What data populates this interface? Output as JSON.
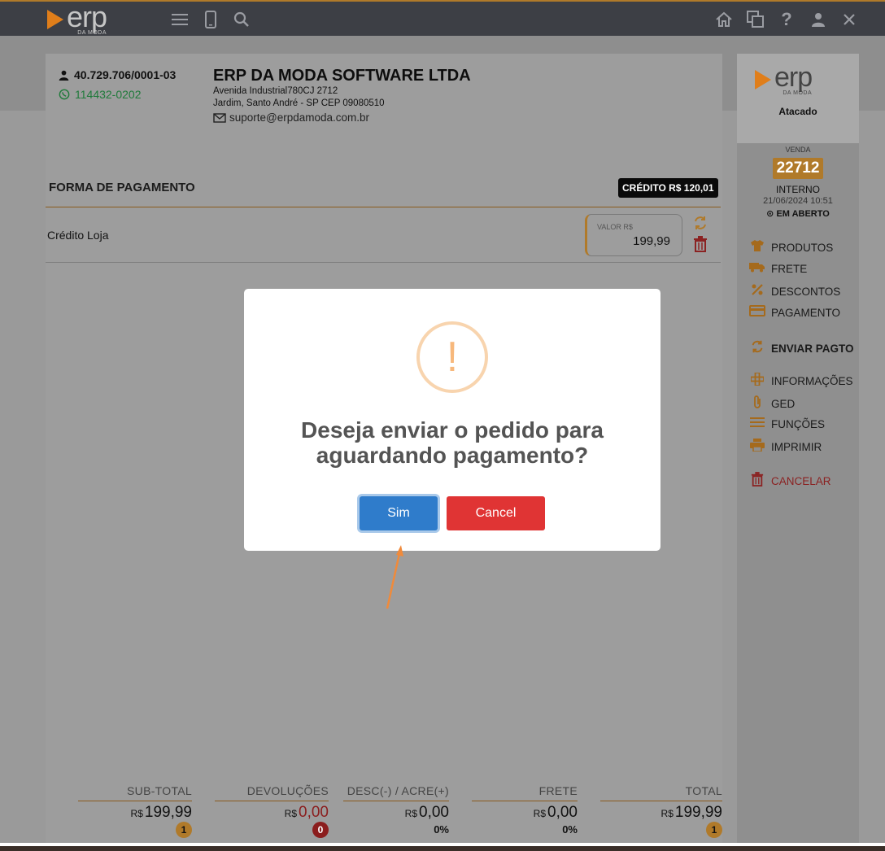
{
  "topbar": {
    "logo_text": "erp",
    "logo_sub": "DA MODA",
    "icons": [
      "menu-icon",
      "mobile-icon",
      "search-icon",
      "home-icon",
      "windows-icon",
      "help-icon",
      "user-icon",
      "close-icon"
    ]
  },
  "company": {
    "cnpj": "40.729.706/0001-03",
    "phone": "114432-0202",
    "name": "ERP DA MODA SOFTWARE LTDA",
    "address_line1": "Avenida Industrial780CJ 2712",
    "address_line2": "Jardim, Santo André - SP CEP 09080510",
    "email": "suporte@erpdamoda.com.br"
  },
  "payment": {
    "title": "FORMA DE PAGAMENTO",
    "credit_badge": "CRÉDITO R$ 120,01",
    "rows": [
      {
        "label": "Crédito Loja",
        "valor_label": "VALOR R$",
        "valor": "199,99"
      }
    ]
  },
  "totals": [
    {
      "label": "SUB-TOTAL",
      "currency": "R$",
      "value": "199,99",
      "badge": "1",
      "badge_color": "#b07a2a"
    },
    {
      "label": "DEVOLUÇÕES",
      "currency": "R$",
      "value": "0,00",
      "badge": "0",
      "badge_color": "#8b1d1d",
      "value_color": "red"
    },
    {
      "label": "DESC(-) / ACRE(+)",
      "currency": "R$",
      "value": "0,00",
      "pct": "0%"
    },
    {
      "label": "FRETE",
      "currency": "R$",
      "value": "0,00",
      "pct": "0%"
    },
    {
      "label": "TOTAL",
      "currency": "R$",
      "value": "199,99",
      "badge": "1",
      "badge_color": "#b07a2a"
    }
  ],
  "sidebar": {
    "logo_text": "erp",
    "logo_sub": "DA MODA",
    "tipo": "Atacado",
    "venda_label": "VENDA",
    "venda_num": "22712",
    "interno": "INTERNO",
    "data": "21/06/2024 10:51",
    "status": "EM ABERTO",
    "menu": [
      {
        "label": "PRODUTOS",
        "icon": "shirt-icon"
      },
      {
        "label": "FRETE",
        "icon": "truck-icon"
      },
      {
        "label": "DESCONTOS",
        "icon": "percent-icon"
      },
      {
        "label": "PAGAMENTO",
        "icon": "card-icon"
      },
      {
        "label": "ENVIAR PAGTO",
        "icon": "refresh-icon"
      },
      {
        "label": "INFORMAÇÕES",
        "icon": "plus-icon"
      },
      {
        "label": "GED",
        "icon": "paperclip-icon"
      },
      {
        "label": "FUNÇÕES",
        "icon": "menu-icon"
      },
      {
        "label": "IMPRIMIR",
        "icon": "printer-icon"
      },
      {
        "label": "CANCELAR",
        "icon": "trash-icon"
      }
    ]
  },
  "modal": {
    "title": "Deseja enviar o pedido para aguardando pagamento?",
    "icon_text": "!",
    "confirm_label": "Sim",
    "cancel_label": "Cancel"
  },
  "colors": {
    "accent": "#e07e1a",
    "confirm": "#2f7ccb",
    "cancel": "#e03434",
    "warning": "#f8bb86"
  }
}
